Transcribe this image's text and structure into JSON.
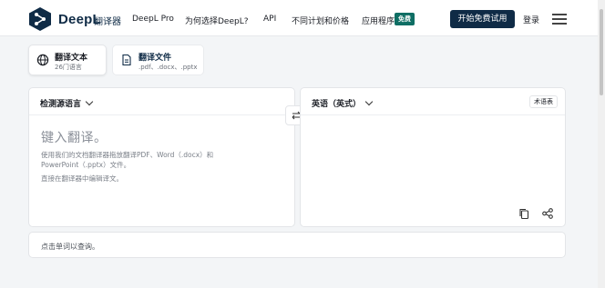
{
  "header": {
    "brand": "DeepL",
    "brand_sub": "翻译器",
    "nav": [
      "DeepL Pro",
      "为何选择DeepL?",
      "API",
      "不同计划和价格",
      "应用程序"
    ],
    "badge": "免费",
    "cta": "开始免费试用",
    "login": "登录"
  },
  "tabs": [
    {
      "title": "翻译文本",
      "sub": "26门语言"
    },
    {
      "title": "翻译文件",
      "sub": ".pdf、.docx、.pptx"
    }
  ],
  "source": {
    "lang": "检测源语言",
    "placeholder": "键入翻译。",
    "hint_line1": "使用我们的文档翻译器拖放翻译PDF、Word（.docx）和",
    "hint_line2": "PowerPoint（.pptx）文件。",
    "hint_line3": "直接在翻译器中编辑译文。"
  },
  "target": {
    "lang": "英语（英式）",
    "glossary": "术语表"
  },
  "dictionary": {
    "text": "点击单词以查询。"
  },
  "colors": {
    "brand": "#0f2b46",
    "badge": "#0f6e64"
  }
}
